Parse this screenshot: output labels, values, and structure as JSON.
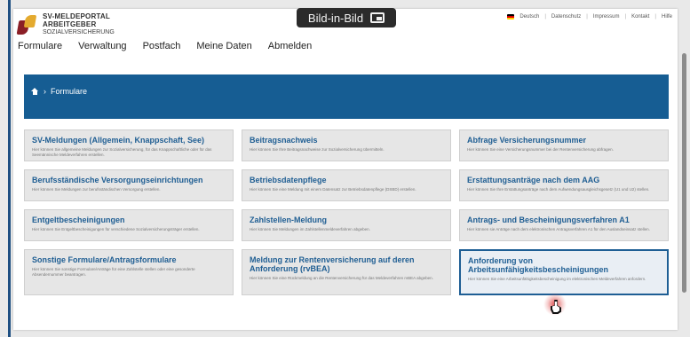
{
  "overlay": {
    "picture_in_picture": "Bild-in-Bild"
  },
  "brand": {
    "line1": "SV-MELDEPORTAL",
    "line2": "ARBEITGEBER",
    "line3": "SOZIALVERSICHERUNG"
  },
  "topbar": {
    "language": "Deutsch",
    "links": [
      "Datenschutz",
      "Impressum",
      "Kontakt",
      "Hilfe"
    ]
  },
  "nav": [
    "Formulare",
    "Verwaltung",
    "Postfach",
    "Meine Daten",
    "Abmelden"
  ],
  "breadcrumb": {
    "current": "Formulare"
  },
  "tiles": [
    {
      "title": "SV-Meldungen (Allgemein, Knappschaft, See)",
      "desc": "Hier können Sie allgemeine Meldungen zur Sozialversicherung, für das Knappschaftliche oder für das Seemännische Meldeverfahren erstellen."
    },
    {
      "title": "Beitragsnachweis",
      "desc": "Hier können Sie Ihre Beitragsnachweise zur Sozialversicherung übermitteln."
    },
    {
      "title": "Abfrage Versicherungsnummer",
      "desc": "Hier können Sie eine Versicherungsnummer bei der Rentenversicherung abfragen."
    },
    {
      "title": "Berufsständische Versorgungseinrichtungen",
      "desc": "Hier können Sie Meldungen zur berufsständischen Versorgung erstellen."
    },
    {
      "title": "Betriebsdatenpflege",
      "desc": "Hier können Sie eine Meldung mit einem Datensatz zur Betriebsdatenpflege (DSBD) erstellen."
    },
    {
      "title": "Erstattungsanträge nach dem AAG",
      "desc": "Hier können Sie Ihre Erstattungsanträge nach dem Aufwendungsausgleichsgesetz (U1 und U2) stellen."
    },
    {
      "title": "Entgeltbescheinigungen",
      "desc": "Hier können Sie Entgeltbescheinigungen für verschiedene Sozialversicherungsträger erstellen."
    },
    {
      "title": "Zahlstellen-Meldung",
      "desc": "Hier können Sie Meldungen im Zahlstellenmeldeverfahren abgeben."
    },
    {
      "title": "Antrags- und Bescheinigungsverfahren A1",
      "desc": "Hier können sie Anträge nach dem elektronischen Antragsverfahren A1 für den Auslandseinsatz stellen."
    },
    {
      "title": "Sonstige Formulare/Antragsformulare",
      "desc": "Hier können Sie sonstige Formulare/Anträge für eine Zahlstelle stellen oder eine gesonderte Absendernummer beantragen."
    },
    {
      "title": "Meldung zur Rentenversicherung auf deren Anforderung (rvBEA)",
      "desc": "Hier können Sie eine Rückmeldung an die Rentenversicherung für das Meldeverfahren rvBEA abgeben."
    },
    {
      "title": "Anforderung von Arbeitsunfähigkeitsbescheinigungen",
      "desc": "Hier können Sie eine Arbeitsunfähigkeitsbescheinigung im elektronischen Meldeverfahren anfordern."
    }
  ]
}
